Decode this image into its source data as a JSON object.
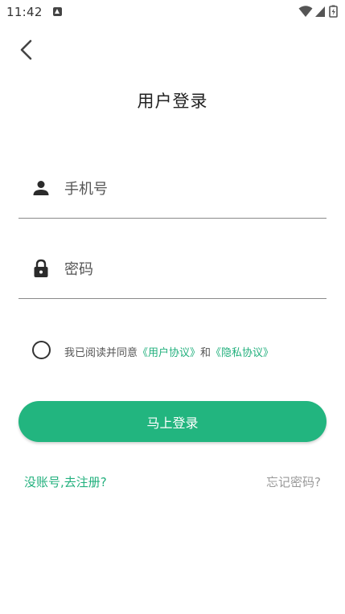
{
  "status_bar": {
    "time": "11:42",
    "icons": [
      "notification-icon",
      "wifi-icon",
      "signal-icon",
      "battery-icon"
    ]
  },
  "header": {
    "back_icon": "chevron-left-icon",
    "title": "用户登录"
  },
  "form": {
    "phone": {
      "icon": "person-icon",
      "placeholder": "手机号",
      "value": ""
    },
    "password": {
      "icon": "lock-icon",
      "placeholder": "密码",
      "value": ""
    }
  },
  "agreement": {
    "checked": false,
    "prefix": "我已阅读并同意",
    "user_agreement": "《用户协议》",
    "conjunction": "和",
    "privacy_policy": "《隐私协议》"
  },
  "actions": {
    "login_label": "马上登录",
    "register_label": "没账号,去注册?",
    "forgot_label": "忘记密码?"
  },
  "colors": {
    "accent": "#22b57f",
    "link": "#22b07d",
    "muted": "#999999"
  }
}
